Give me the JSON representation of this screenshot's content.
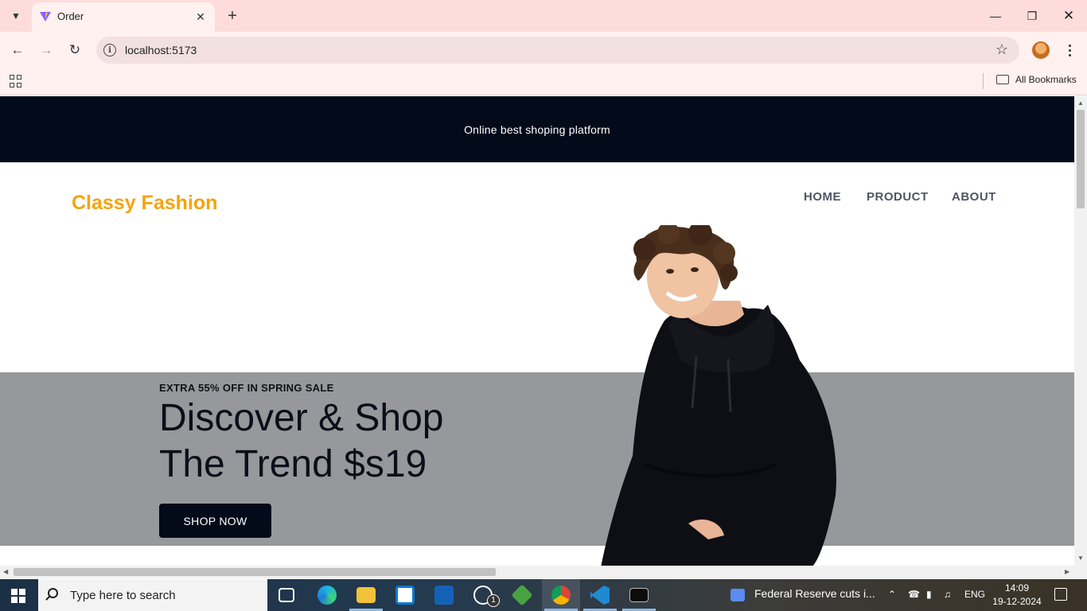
{
  "browser": {
    "tab_title": "Order",
    "url": "localhost:5173",
    "bookmarks_label": "All Bookmarks"
  },
  "page": {
    "announcement": "Online best shoping platform",
    "brand": "Classy Fashion",
    "nav": [
      "HOME",
      "PRODUCT",
      "ABOUT"
    ],
    "hero": {
      "eyebrow": "EXTRA 55% OFF IN SPRING SALE",
      "title_line1": "Discover & Shop",
      "title_line2": "The Trend $s19",
      "button": "SHOP NOW"
    }
  },
  "colors": {
    "announcement_bg": "#030a1a",
    "brand": "#f5a40c",
    "hero_band": "#97989b",
    "button_bg": "#030a1a"
  },
  "taskbar": {
    "search_placeholder": "Type here to search",
    "whatsapp_badge": "1",
    "news": "Federal Reserve cuts i...",
    "language": "ENG",
    "time": "14:09",
    "date": "19-12-2024",
    "icons": [
      "task-view-icon",
      "edge-icon",
      "file-explorer-icon",
      "store-icon",
      "outlook-icon",
      "whatsapp-icon",
      "node-icon",
      "chrome-icon",
      "vscode-icon",
      "terminal-icon"
    ]
  }
}
